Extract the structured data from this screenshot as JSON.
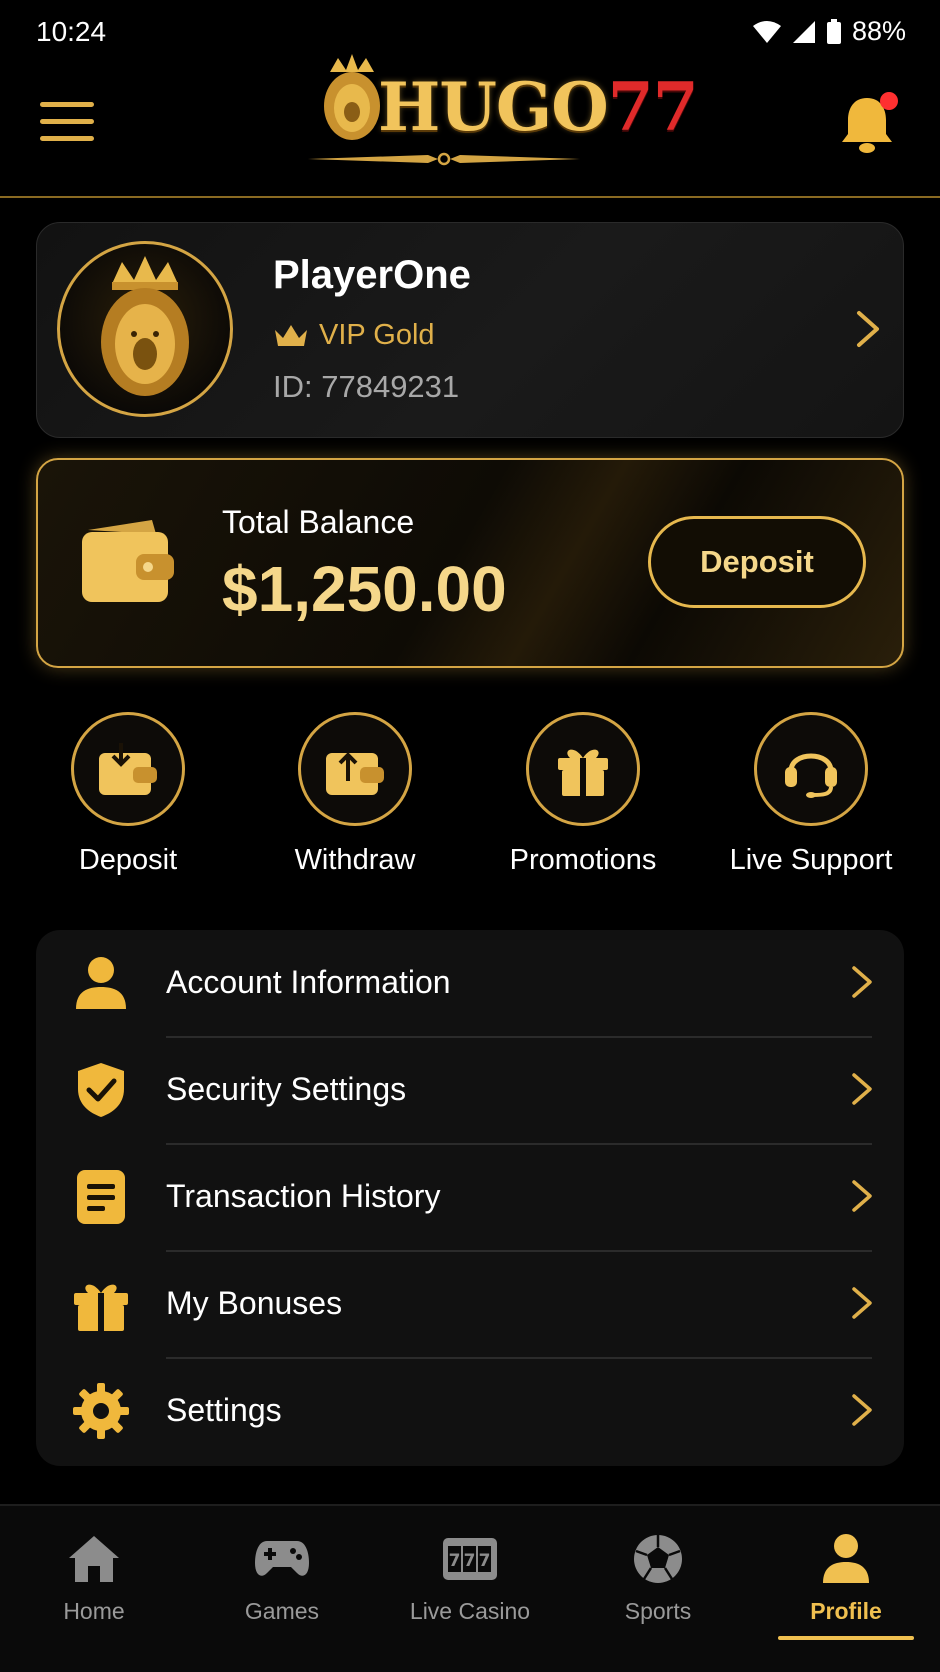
{
  "status_bar": {
    "time": "10:24",
    "battery": "88%"
  },
  "header": {
    "logo_main": "HUGO",
    "logo_accent": "77"
  },
  "profile": {
    "name": "PlayerOne",
    "vip_label": "VIP Gold",
    "id_text": "ID: 77849231"
  },
  "balance": {
    "label": "Total Balance",
    "amount": "$1,250.00",
    "deposit_button": "Deposit"
  },
  "quick_actions": [
    {
      "label": "Deposit",
      "icon": "wallet-in-icon"
    },
    {
      "label": "Withdraw",
      "icon": "wallet-out-icon"
    },
    {
      "label": "Promotions",
      "icon": "gift-icon"
    },
    {
      "label": "Live Support",
      "icon": "headset-icon"
    }
  ],
  "menu": [
    {
      "label": "Account Information",
      "icon": "user-icon"
    },
    {
      "label": "Security Settings",
      "icon": "shield-check-icon"
    },
    {
      "label": "Transaction History",
      "icon": "document-icon"
    },
    {
      "label": "My Bonuses",
      "icon": "gift-icon"
    },
    {
      "label": "Settings",
      "icon": "gear-icon"
    }
  ],
  "bottom_nav": [
    {
      "label": "Home",
      "icon": "home-icon"
    },
    {
      "label": "Games",
      "icon": "gamepad-icon"
    },
    {
      "label": "Live Casino",
      "icon": "slot-777-icon"
    },
    {
      "label": "Sports",
      "icon": "soccer-ball-icon"
    },
    {
      "label": "Profile",
      "icon": "profile-icon",
      "active": true
    }
  ],
  "colors": {
    "gold": "#e0b04a",
    "gold_light": "#f5d78a",
    "background": "#000000",
    "card": "#111111",
    "notification_dot": "#ff3030"
  }
}
